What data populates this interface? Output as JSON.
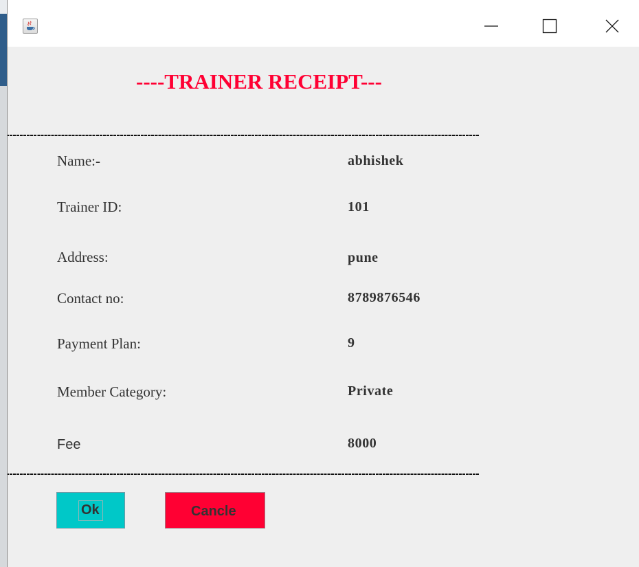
{
  "window": {
    "title": "",
    "icon": "java-cup-icon"
  },
  "receipt": {
    "heading": "----TRAINER RECEIPT---",
    "fields": [
      {
        "label": "Name:-",
        "value": "abhishek"
      },
      {
        "label": "Trainer ID:",
        "value": "101"
      },
      {
        "label": "Address:",
        "value": "pune"
      },
      {
        "label": "Contact no:",
        "value": "8789876546"
      },
      {
        "label": "Payment Plan:",
        "value": "9"
      },
      {
        "label": "Member Category:",
        "value": "Private"
      },
      {
        "label": "Fee",
        "value": "8000"
      }
    ]
  },
  "buttons": {
    "ok_label": "Ok",
    "cancel_label": "Cancle"
  },
  "colors": {
    "heading": "#ff0033",
    "ok_button": "#00c8c8",
    "cancel_button": "#ff0033",
    "window_background": "#efefef"
  }
}
